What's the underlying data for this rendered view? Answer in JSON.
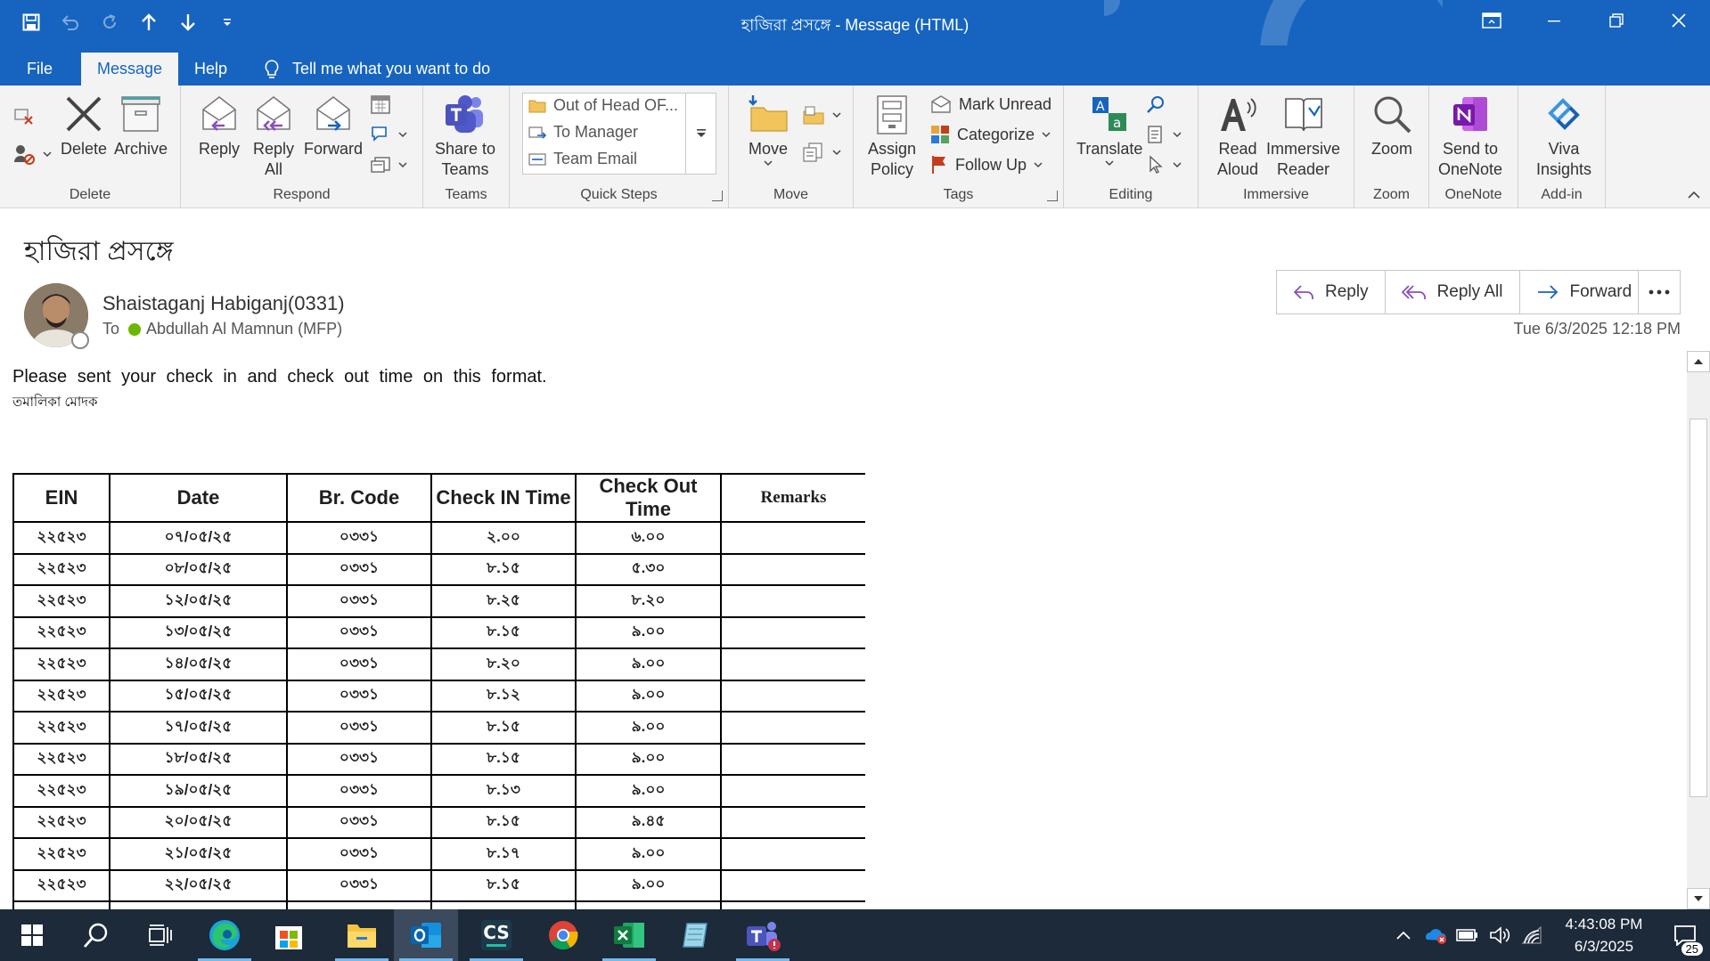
{
  "window": {
    "title": "হাজিরা প্রসঙ্গে  -  Message (HTML)"
  },
  "menu": {
    "tabs": [
      {
        "label": "File"
      },
      {
        "label": "Message"
      },
      {
        "label": "Help"
      }
    ],
    "tell_me": "Tell me what you want to do"
  },
  "ribbon": {
    "delete": {
      "delete_label": "Delete",
      "archive_label": "Archive",
      "group": "Delete"
    },
    "respond": {
      "reply": "Reply",
      "reply_all_1": "Reply",
      "reply_all_2": "All",
      "forward": "Forward",
      "group": "Respond"
    },
    "teams": {
      "share_1": "Share to",
      "share_2": "Teams",
      "group": "Teams"
    },
    "quick_steps": {
      "items": [
        "Out of Head OF...",
        "To Manager",
        "Team Email"
      ],
      "group": "Quick Steps"
    },
    "move": {
      "move": "Move",
      "group": "Move"
    },
    "tags": {
      "assign_1": "Assign",
      "assign_2": "Policy",
      "mark_unread": "Mark Unread",
      "categorize": "Categorize",
      "follow_up": "Follow Up",
      "group": "Tags"
    },
    "editing": {
      "translate": "Translate",
      "group": "Editing"
    },
    "immersive": {
      "read_1": "Read",
      "read_2": "Aloud",
      "reader_1": "Immersive",
      "reader_2": "Reader",
      "group": "Immersive"
    },
    "zoom": {
      "zoom": "Zoom",
      "group": "Zoom"
    },
    "onenote": {
      "send_1": "Send to",
      "send_2": "OneNote",
      "group": "OneNote"
    },
    "addin": {
      "viva_1": "Viva",
      "viva_2": "Insights",
      "group": "Add-in"
    }
  },
  "message": {
    "subject": "হাজিরা প্রসঙ্গে",
    "sender": "Shaistaganj Habiganj(0331)",
    "to_label": "To",
    "recipient": "Abdullah Al Mamnun (MFP)",
    "date": "Tue 6/3/2025 12:18 PM",
    "actions": {
      "reply": "Reply",
      "reply_all": "Reply All",
      "forward": "Forward"
    },
    "body_line": "Please sent your check in and check out time on this format.",
    "signature": "তমালিকা মোদক"
  },
  "table": {
    "headers": [
      "EIN",
      "Date",
      "Br. Code",
      "Check IN Time",
      "Check Out Time",
      "Remarks"
    ],
    "rows": [
      [
        "২২৫২৩",
        "০৭/০৫/২৫",
        "০৩৩১",
        "২.০০",
        "৬.০০",
        ""
      ],
      [
        "২২৫২৩",
        "০৮/০৫/২৫",
        "০৩৩১",
        "৮.১৫",
        "৫.৩০",
        ""
      ],
      [
        "২২৫২৩",
        "১২/০৫/২৫",
        "০৩৩১",
        "৮.২৫",
        "৮.২০",
        ""
      ],
      [
        "২২৫২৩",
        "১৩/০৫/২৫",
        "০৩৩১",
        "৮.১৫",
        "৯.০০",
        ""
      ],
      [
        "২২৫২৩",
        "১৪/০৫/২৫",
        "০৩৩১",
        "৮.২০",
        "৯.০০",
        ""
      ],
      [
        "২২৫২৩",
        "১৫/০৫/২৫",
        "০৩৩১",
        "৮.১২",
        "৯.০০",
        ""
      ],
      [
        "২২৫২৩",
        "১৭/০৫/২৫",
        "০৩৩১",
        "৮.১৫",
        "৯.০০",
        ""
      ],
      [
        "২২৫২৩",
        "১৮/০৫/২৫",
        "০৩৩১",
        "৮.১৫",
        "৯.০০",
        ""
      ],
      [
        "২২৫২৩",
        "১৯/০৫/২৫",
        "০৩৩১",
        "৮.১৩",
        "৯.০০",
        ""
      ],
      [
        "২২৫২৩",
        "২০/০৫/২৫",
        "০৩৩১",
        "৮.১৫",
        "৯.৪৫",
        ""
      ],
      [
        "২২৫২৩",
        "২১/০৫/২৫",
        "০৩৩১",
        "৮.১৭",
        "৯.০০",
        ""
      ],
      [
        "২২৫২৩",
        "২২/০৫/২৫",
        "০৩৩১",
        "৮.১৫",
        "৯.০০",
        ""
      ],
      [
        "",
        "",
        "",
        "",
        "",
        ""
      ]
    ]
  },
  "taskbar": {
    "time": "4:43:08 PM",
    "date": "6/3/2025",
    "notification_count": "25",
    "cs_label": "CS"
  },
  "colors": {
    "title_bar": "#1664c0",
    "ribbon": "#f3f3f3",
    "taskbar": "#1c2a3a",
    "presence_green": "#6bb700"
  }
}
